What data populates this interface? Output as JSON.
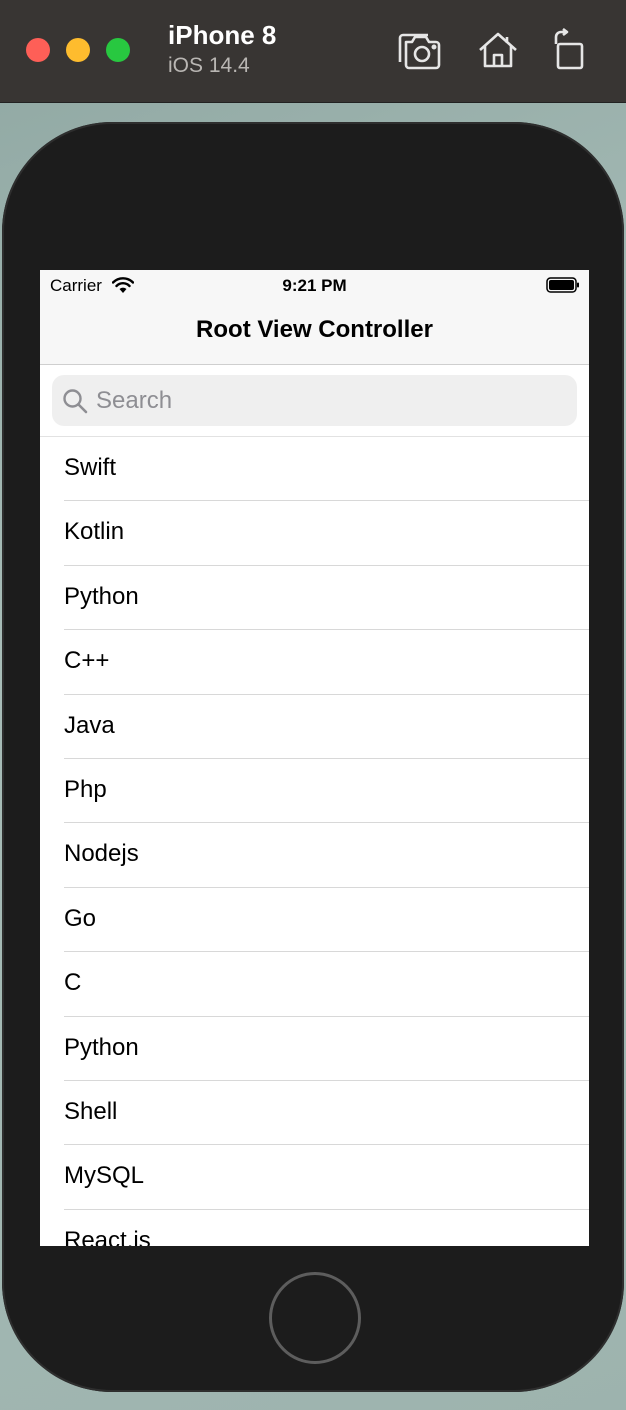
{
  "simulator": {
    "device_name": "iPhone 8",
    "os_version": "iOS 14.4",
    "toolbar_icons": [
      "screenshot-icon",
      "home-icon",
      "rotate-icon"
    ]
  },
  "status_bar": {
    "carrier": "Carrier",
    "time": "9:21 PM",
    "icons": [
      "wifi-icon",
      "battery-icon"
    ]
  },
  "nav": {
    "title": "Root View Controller"
  },
  "search": {
    "placeholder": "Search",
    "value": ""
  },
  "list": {
    "items": [
      "Swift",
      "Kotlin",
      "Python",
      "C++",
      "Java",
      "Php",
      "Nodejs",
      "Go",
      "C",
      "Python",
      "Shell",
      "MySQL",
      "React.js"
    ]
  },
  "colors": {
    "close": "#fe5f57",
    "minimize": "#febc2e",
    "zoom": "#28c840"
  }
}
